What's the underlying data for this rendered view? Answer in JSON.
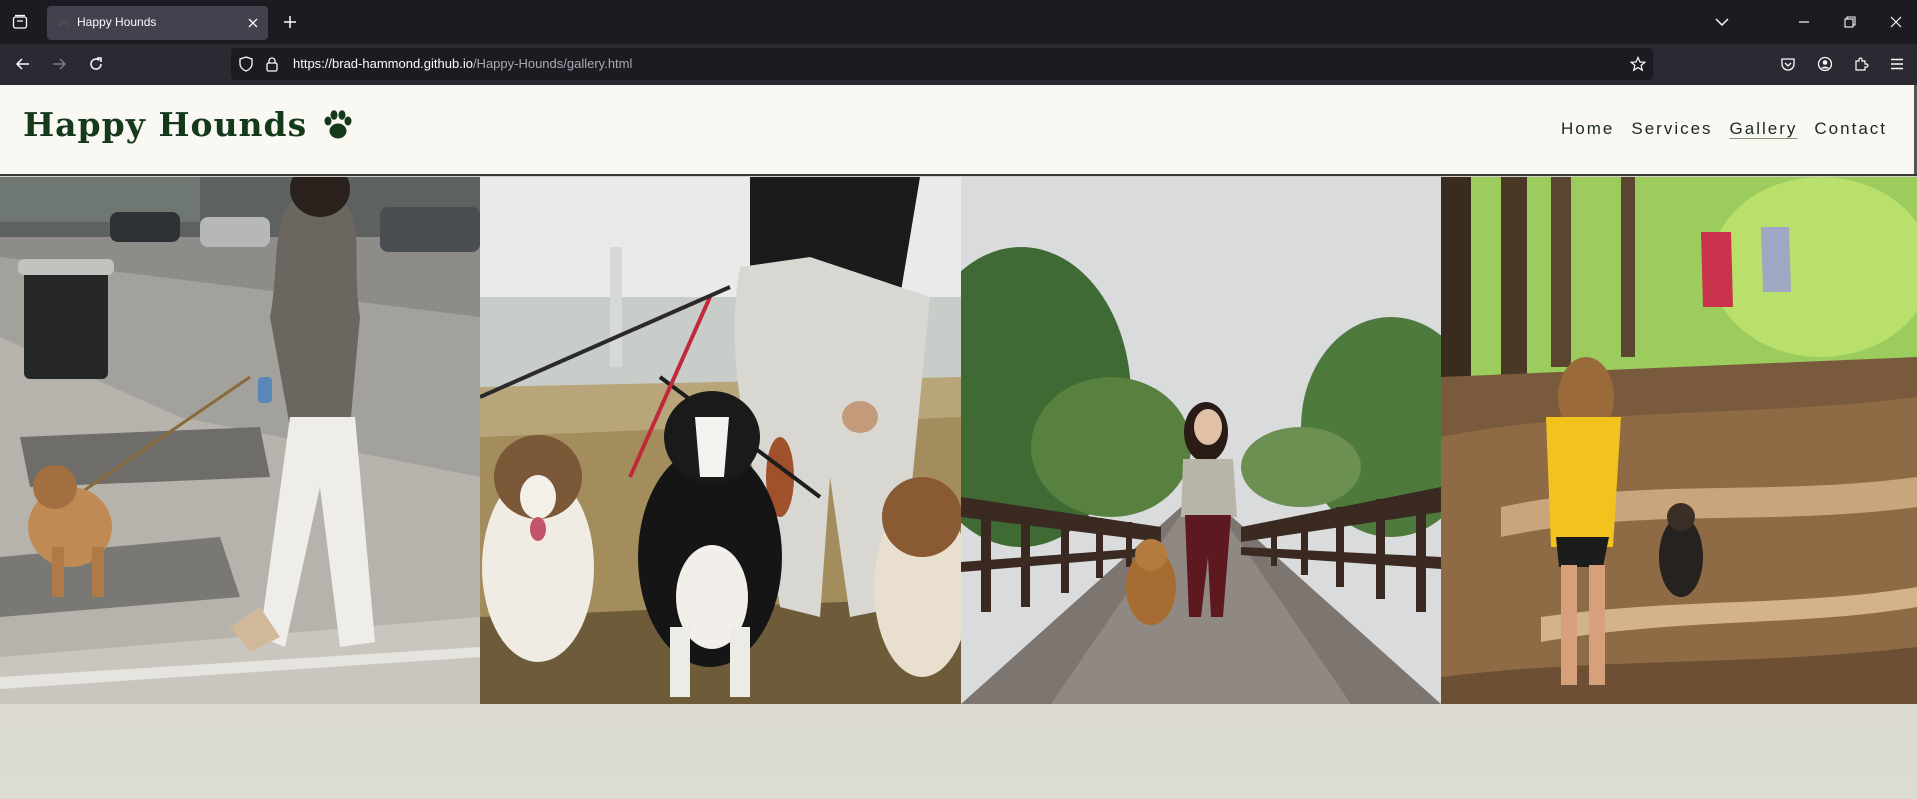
{
  "browser": {
    "tab": {
      "title": "Happy Hounds"
    },
    "url": {
      "host": "https://brad-hammond.github.io",
      "path": "/Happy-Hounds/gallery.html"
    }
  },
  "site": {
    "logo_text": "Happy Hounds",
    "nav": [
      {
        "label": "Home",
        "active": false
      },
      {
        "label": "Services",
        "active": false
      },
      {
        "label": "Gallery",
        "active": true
      },
      {
        "label": "Contact",
        "active": false
      }
    ]
  },
  "gallery": {
    "photos": [
      {
        "name": "city-walk-photo"
      },
      {
        "name": "border-collie-photo"
      },
      {
        "name": "boardwalk-photo"
      },
      {
        "name": "forest-trail-photo"
      }
    ]
  },
  "colors": {
    "brand_green": "#16391b",
    "header_bg": "#f9f8f3",
    "chrome_bg": "#1c1b22",
    "chrome_toolbar": "#2b2a33"
  },
  "icons": [
    "tab-list-icon",
    "dog-favicon-icon",
    "close-icon",
    "plus-icon",
    "chevron-down-icon",
    "minimize-icon",
    "restore-icon",
    "close-window-icon",
    "back-icon",
    "forward-icon",
    "reload-icon",
    "shield-icon",
    "lock-icon",
    "star-icon",
    "pocket-icon",
    "account-icon",
    "extensions-icon",
    "menu-icon",
    "paw-icon"
  ]
}
